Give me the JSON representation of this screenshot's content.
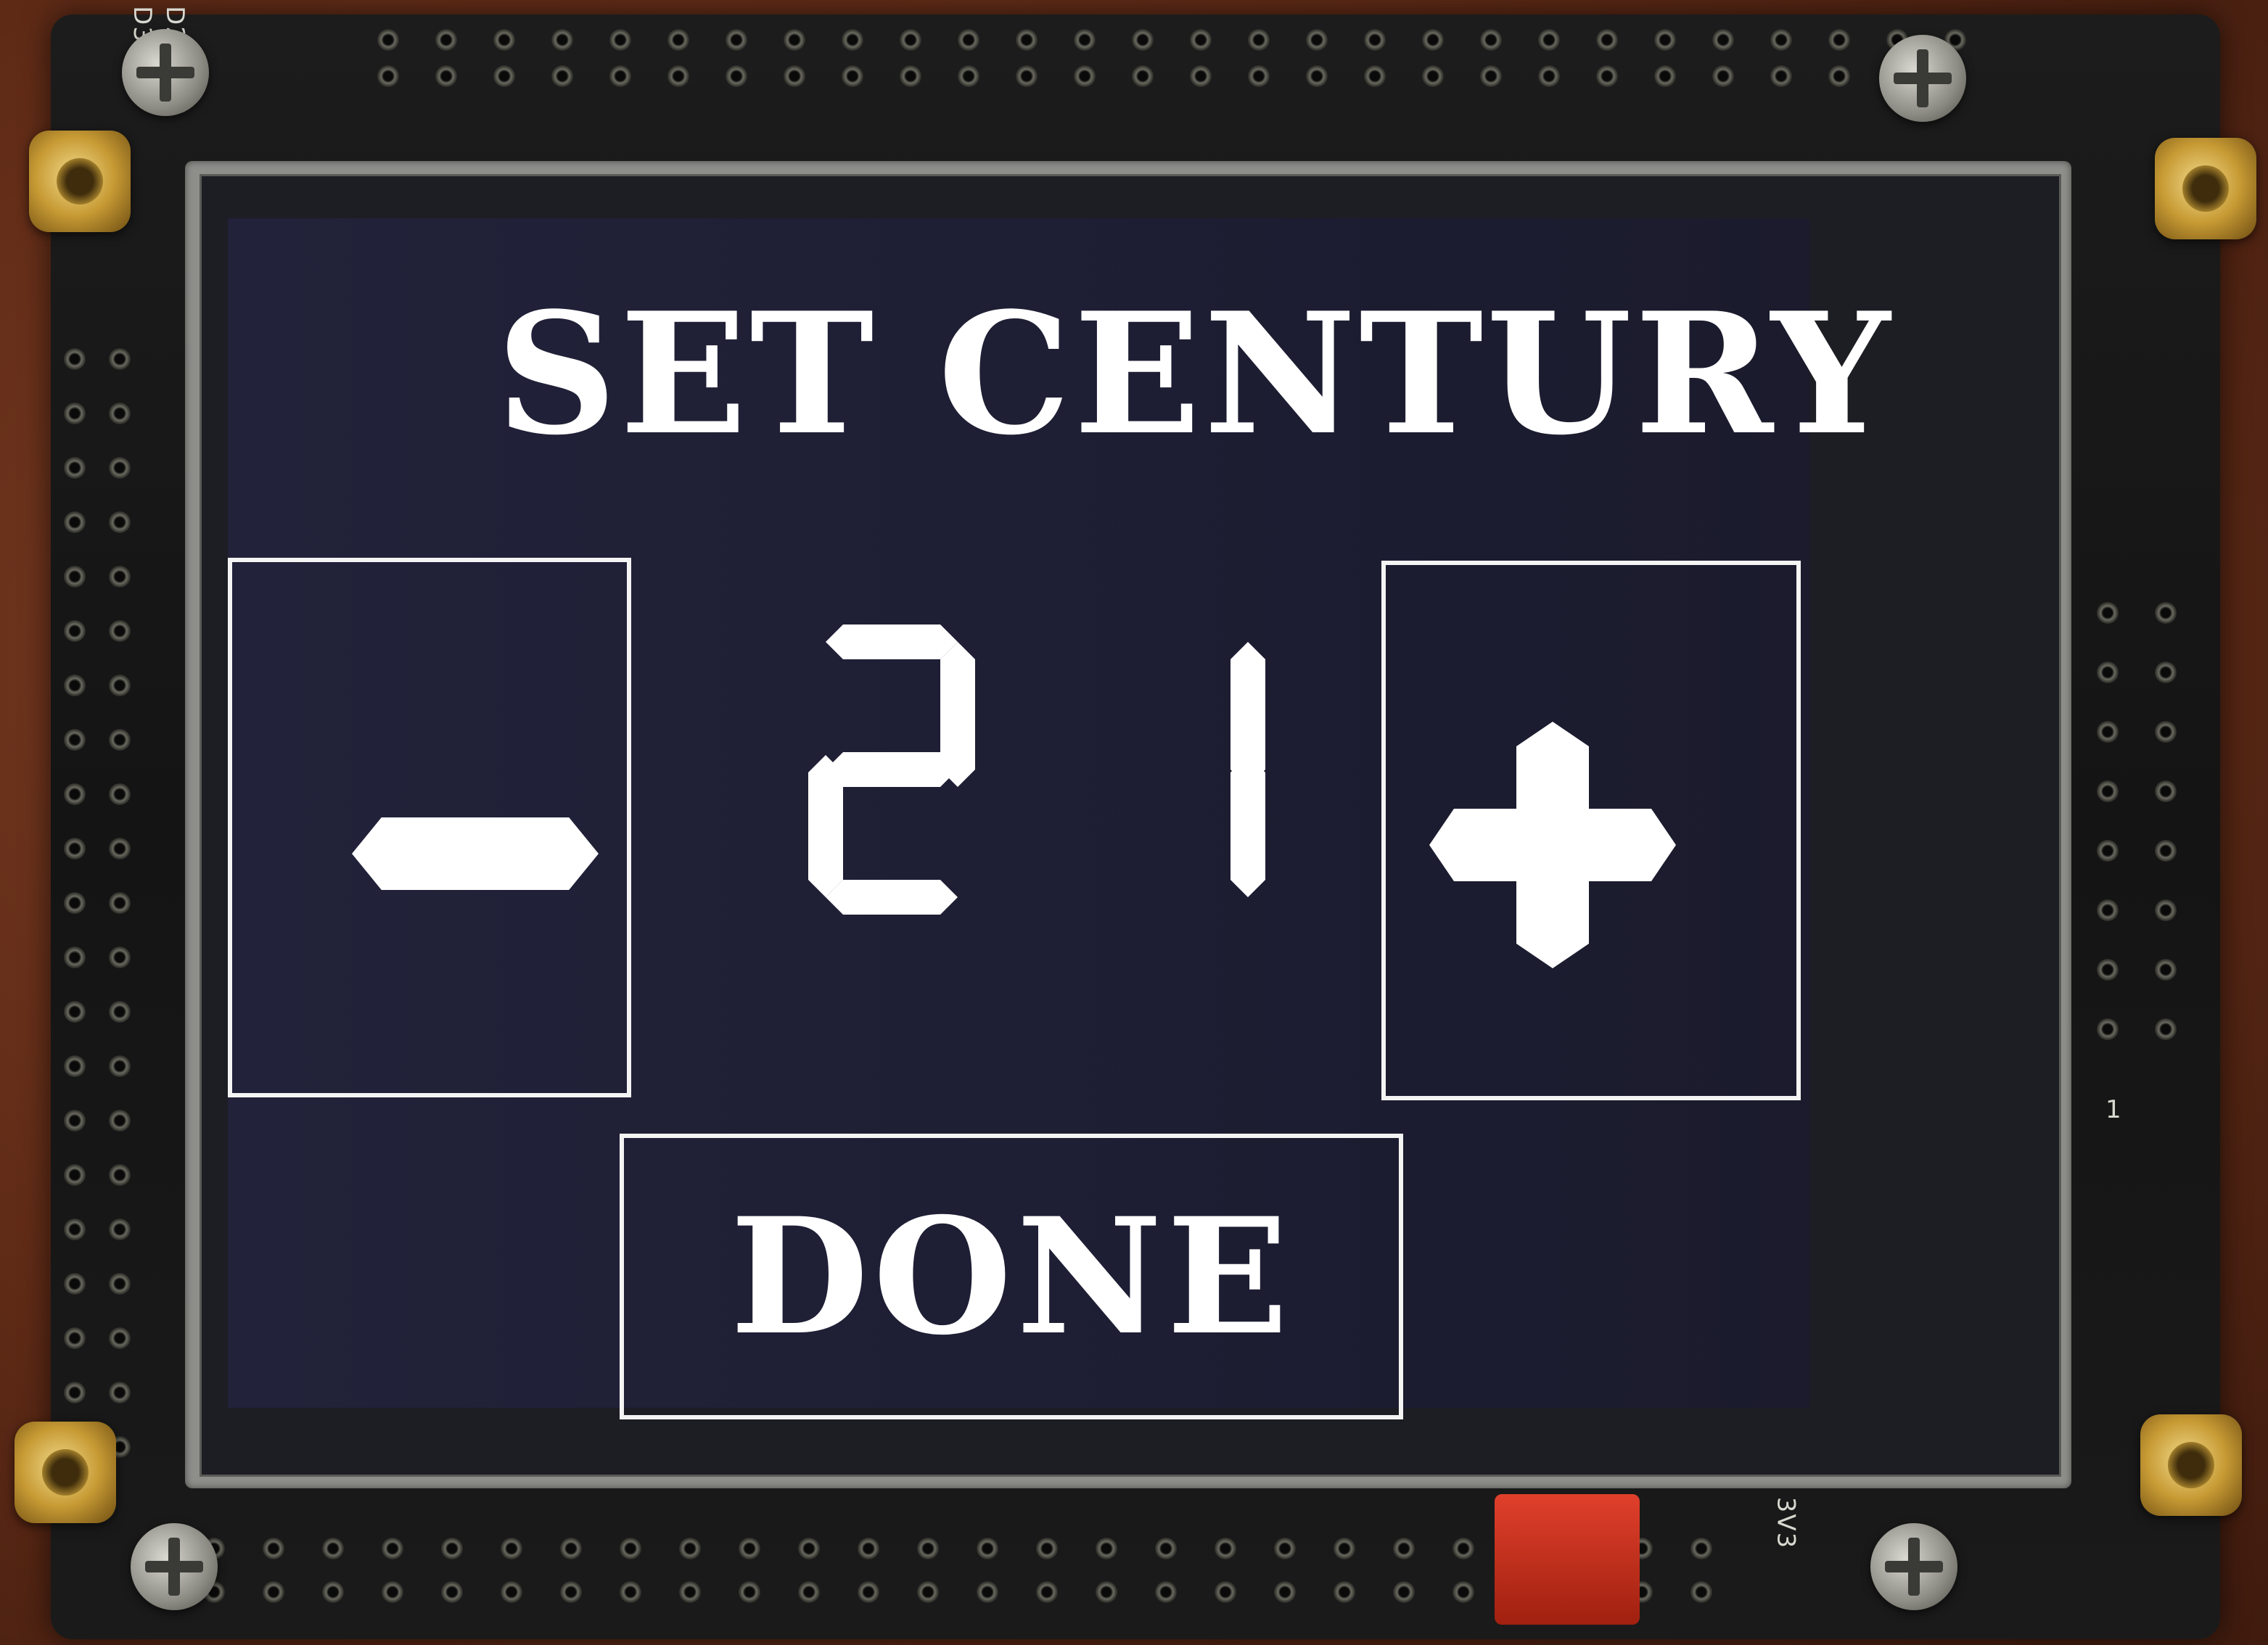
{
  "screen": {
    "title": "SET CENTURY",
    "value": "21",
    "decrement_symbol": "−",
    "increment_symbol": "+",
    "done_label": "DONE"
  },
  "board": {
    "silkscreen_d2": "D2",
    "silkscreen_d3": "D3",
    "silkscreen_pin1": "1",
    "silkscreen_3v3": "3V3"
  },
  "colors": {
    "display_background": "#1d1d33",
    "foreground": "#ffffff",
    "pcb": "#161616",
    "standoff_brass": "#c79a34",
    "jumper": "#c83020"
  },
  "icons": {
    "decrement": "minus-icon",
    "increment": "plus-icon"
  }
}
